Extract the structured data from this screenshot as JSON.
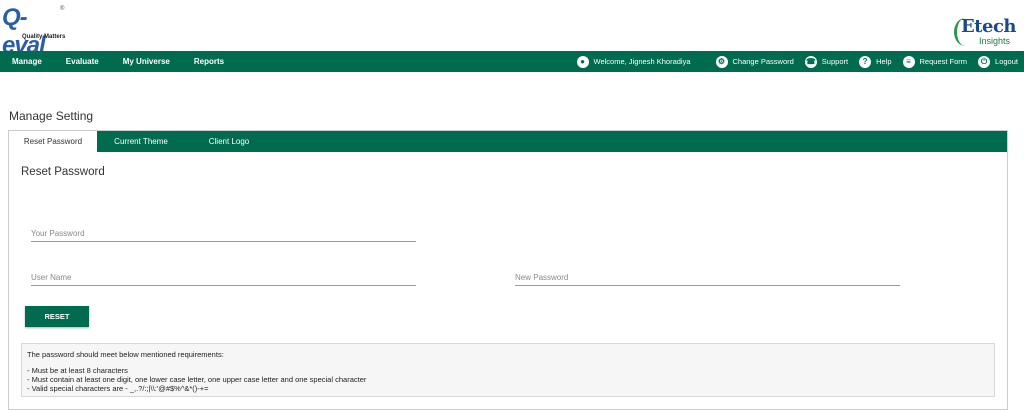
{
  "logo_left": {
    "text": "Q-eval",
    "trademark": "®",
    "tagline": "Quality Matters"
  },
  "logo_right": {
    "brand": "Etech",
    "sub": "Insights"
  },
  "nav": {
    "left": [
      "Manage",
      "Evaluate",
      "My Universe",
      "Reports"
    ],
    "right": [
      {
        "label": "Welcome, Jignesh Khoradiya",
        "icon": "user-icon"
      },
      {
        "label": "Change Password",
        "icon": "gear-icon"
      },
      {
        "label": "Support",
        "icon": "support-icon"
      },
      {
        "label": "Help",
        "icon": "help-icon"
      },
      {
        "label": "Request Form",
        "icon": "form-icon"
      },
      {
        "label": "Logout",
        "icon": "power-icon"
      }
    ]
  },
  "page_title": "Manage Setting",
  "tabs": [
    "Reset Password",
    "Current Theme",
    "Client Logo"
  ],
  "section_title": "Reset Password",
  "fields": {
    "your_password": {
      "placeholder": "Your Password",
      "value": ""
    },
    "user_name": {
      "placeholder": "User Name",
      "value": ""
    },
    "new_password": {
      "placeholder": "New Password",
      "value": ""
    }
  },
  "reset_button": "RESET",
  "requirements": {
    "heading": "The password should meet below mentioned requirements:",
    "lines": [
      "- Must be at least 8 characters",
      "- Must contain at least one digit, one lower case letter, one upper case letter and one special character",
      "- Valid special characters are - _,.?/:;|\\\\:'@#$%^&*()-+="
    ]
  },
  "colors": {
    "brand_green": "#006b4f",
    "logo_blue": "#2a5ea8"
  }
}
